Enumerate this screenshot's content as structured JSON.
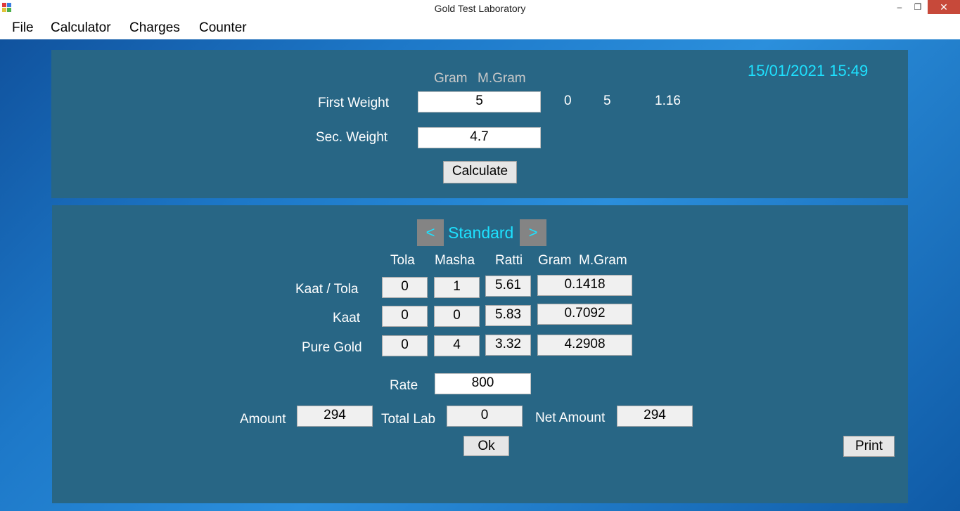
{
  "window": {
    "title": "Gold Test Laboratory",
    "minimize_symbol": "–",
    "maximize_symbol": "❐",
    "close_symbol": "✕"
  },
  "menu": [
    "File",
    "Calculator",
    "Charges",
    "Counter"
  ],
  "weights": {
    "unit_gram": "Gram",
    "unit_mgram": "M.Gram",
    "first_label": "First Weight",
    "first_value": "5",
    "first_results": [
      "0",
      "5",
      "1.16"
    ],
    "second_label": "Sec. Weight",
    "second_value": "4.7",
    "calculate_label": "Calculate",
    "datetime": "15/01/2021 15:49"
  },
  "standard": {
    "prev": "<",
    "label": "Standard",
    "next": ">",
    "columns": [
      "Tola",
      "Masha",
      "Ratti",
      "Gram  M.Gram"
    ],
    "rows": [
      {
        "label": "Kaat / Tola",
        "tola": "0",
        "masha": "1",
        "ratti": "5.61",
        "gram": "0.1418"
      },
      {
        "label": "Kaat",
        "tola": "0",
        "masha": "0",
        "ratti": "5.83",
        "gram": "0.7092"
      },
      {
        "label": "Pure Gold",
        "tola": "0",
        "masha": "4",
        "ratti": "3.32",
        "gram": "4.2908"
      }
    ],
    "rate_label": "Rate",
    "rate_value": "800",
    "amount_label": "Amount",
    "amount_value": "294",
    "total_lab_label": "Total Lab",
    "total_lab_value": "0",
    "net_amount_label": "Net Amount",
    "net_amount_value": "294",
    "ok_label": "Ok",
    "print_label": "Print"
  }
}
